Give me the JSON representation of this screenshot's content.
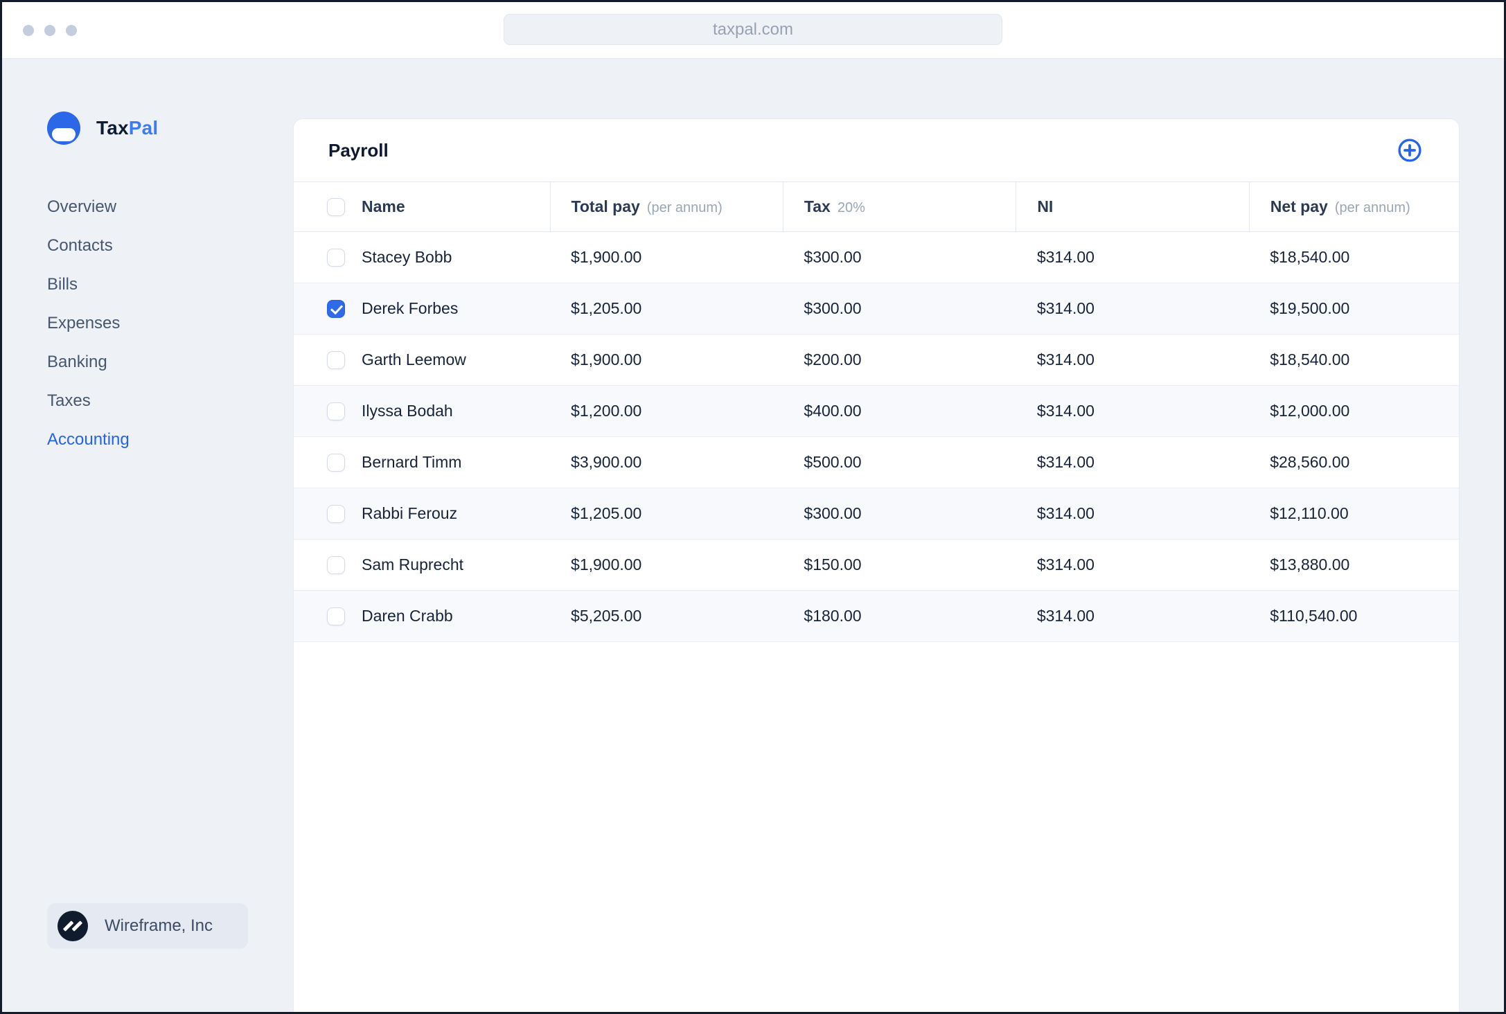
{
  "browser": {
    "url": "taxpal.com"
  },
  "sidebar": {
    "logo": {
      "brand_prefix": "Tax",
      "brand_suffix": "Pal"
    },
    "items": [
      {
        "label": "Overview",
        "active": false
      },
      {
        "label": "Contacts",
        "active": false
      },
      {
        "label": "Bills",
        "active": false
      },
      {
        "label": "Expenses",
        "active": false
      },
      {
        "label": "Banking",
        "active": false
      },
      {
        "label": "Taxes",
        "active": false
      },
      {
        "label": "Accounting",
        "active": true
      }
    ],
    "org": {
      "name": "Wireframe, Inc"
    }
  },
  "payroll": {
    "title": "Payroll",
    "columns": [
      {
        "label": "Name",
        "sub": ""
      },
      {
        "label": "Total pay",
        "sub": "(per annum)"
      },
      {
        "label": "Tax",
        "sub": "20%"
      },
      {
        "label": "NI",
        "sub": ""
      },
      {
        "label": "Net pay",
        "sub": "(per annum)"
      }
    ],
    "rows": [
      {
        "name": "Stacey Bobb",
        "checked": false,
        "total_pay": "$1,900.00",
        "tax": "$300.00",
        "ni": "$314.00",
        "net_pay": "$18,540.00"
      },
      {
        "name": "Derek Forbes",
        "checked": true,
        "total_pay": "$1,205.00",
        "tax": "$300.00",
        "ni": "$314.00",
        "net_pay": "$19,500.00"
      },
      {
        "name": "Garth Leemow",
        "checked": false,
        "total_pay": "$1,900.00",
        "tax": "$200.00",
        "ni": "$314.00",
        "net_pay": "$18,540.00"
      },
      {
        "name": "Ilyssa Bodah",
        "checked": false,
        "total_pay": "$1,200.00",
        "tax": "$400.00",
        "ni": "$314.00",
        "net_pay": "$12,000.00"
      },
      {
        "name": "Bernard Timm",
        "checked": false,
        "total_pay": "$3,900.00",
        "tax": "$500.00",
        "ni": "$314.00",
        "net_pay": "$28,560.00"
      },
      {
        "name": "Rabbi Ferouz",
        "checked": false,
        "total_pay": "$1,205.00",
        "tax": "$300.00",
        "ni": "$314.00",
        "net_pay": "$12,110.00"
      },
      {
        "name": "Sam Ruprecht",
        "checked": false,
        "total_pay": "$1,900.00",
        "tax": "$150.00",
        "ni": "$314.00",
        "net_pay": "$13,880.00"
      },
      {
        "name": "Daren Crabb",
        "checked": false,
        "total_pay": "$5,205.00",
        "tax": "$180.00",
        "ni": "$314.00",
        "net_pay": "$110,540.00"
      }
    ]
  },
  "colors": {
    "accent": "#2563eb",
    "accent_logo": "#2c67e8",
    "brand_navy": "#101c33",
    "page_background": "#eef1f6",
    "row_stripe": "#f7f9fc",
    "muted_text": "#9aa6b6",
    "org_icon_navy": "#111b2e"
  }
}
